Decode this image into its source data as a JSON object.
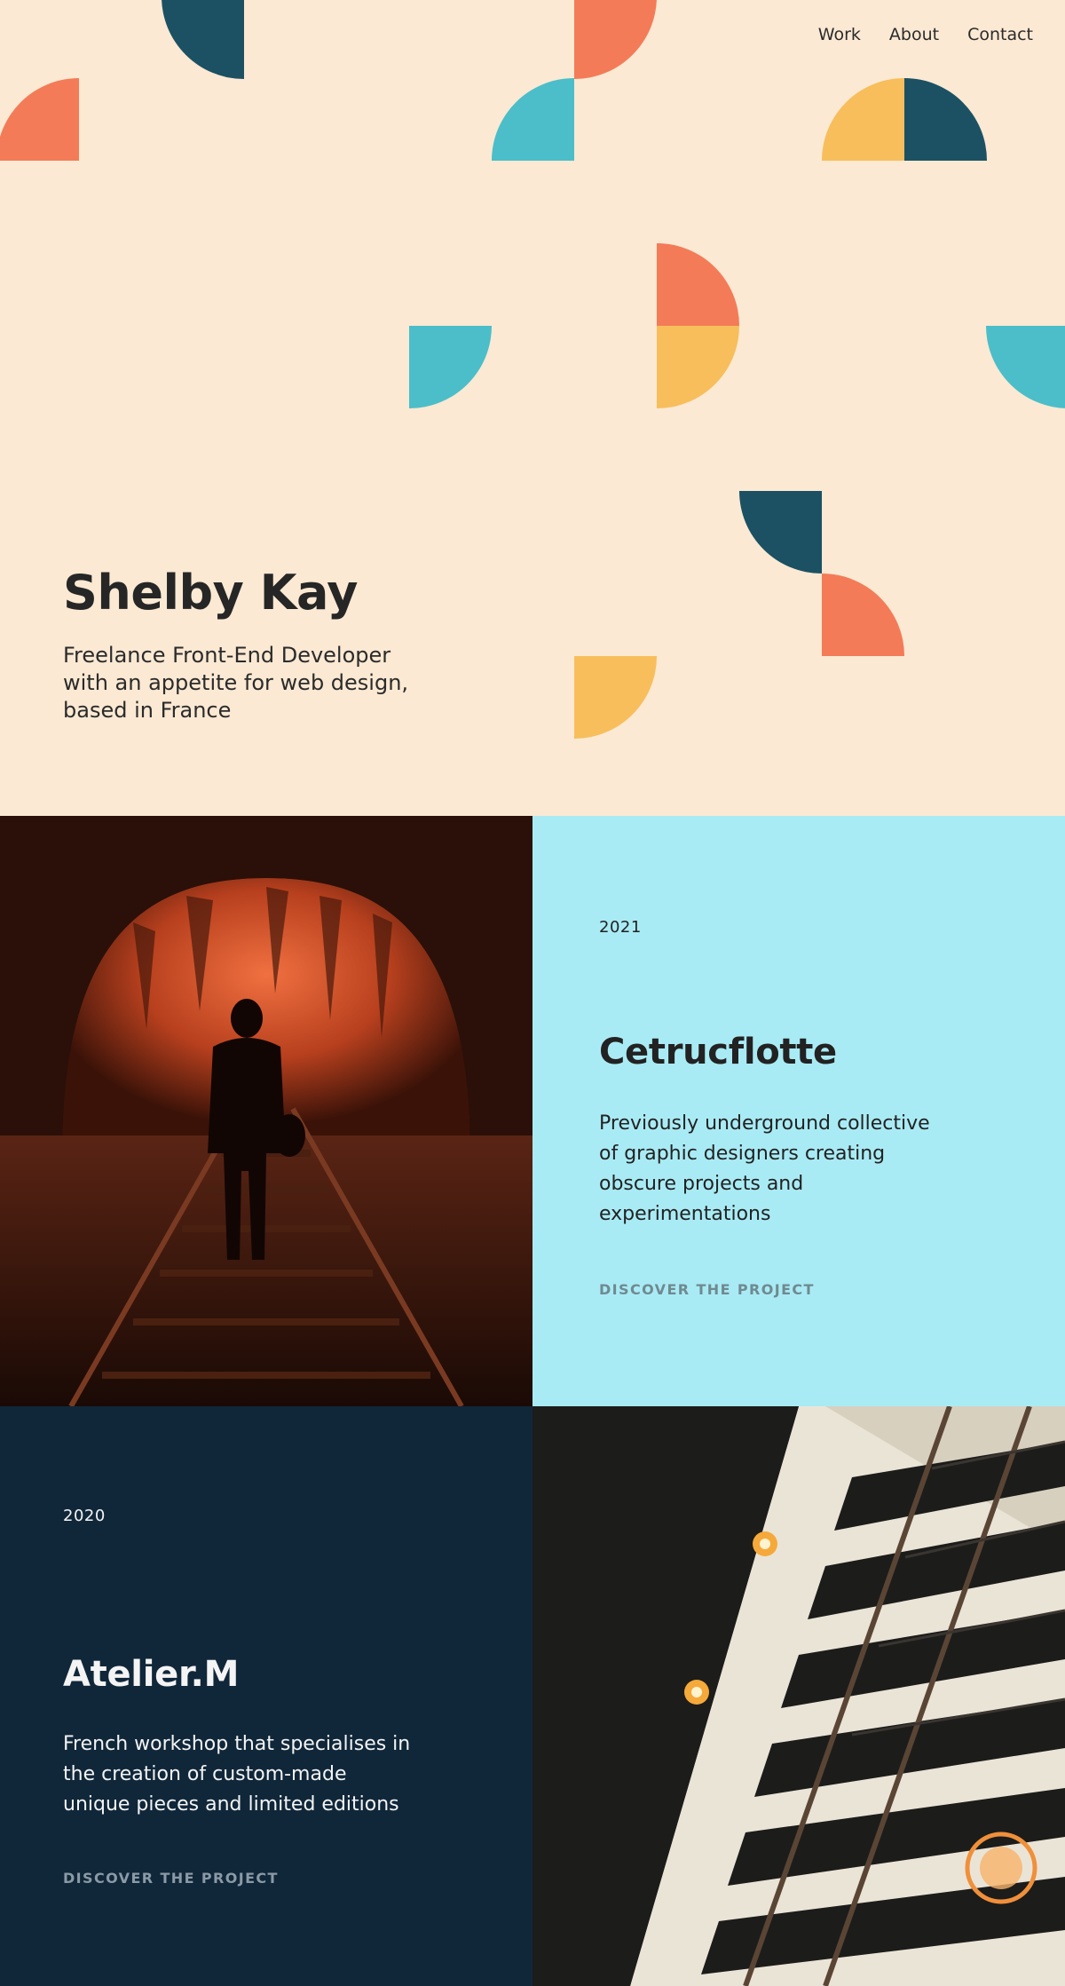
{
  "nav": {
    "work": "Work",
    "about": "About",
    "contact": "Contact"
  },
  "hero": {
    "name": "Shelby Kay",
    "tagline": "Freelance Front-End Developer with an appetite for web design, based in France"
  },
  "colors": {
    "cream": "#fbe9d3",
    "teal_dark": "#1b5163",
    "coral": "#f47b57",
    "aqua": "#4bbec9",
    "yellow": "#f8be5c",
    "light_blue_panel": "#a9ebf5",
    "navy_panel": "#10273a"
  },
  "projects": [
    {
      "year": "2021",
      "title": "Cetrucflotte",
      "description": "Previously underground collective of graphic designers creating obscure projects and experimentations",
      "link": "DISCOVER THE PROJECT",
      "image": "tunnel-railway-photo"
    },
    {
      "year": "2020",
      "title": "Atelier.M",
      "description": "French workshop that specialises in the creation of custom-made unique pieces and limited editions",
      "link": "DISCOVER THE PROJECT",
      "image": "staircase-lamps-photo"
    }
  ]
}
